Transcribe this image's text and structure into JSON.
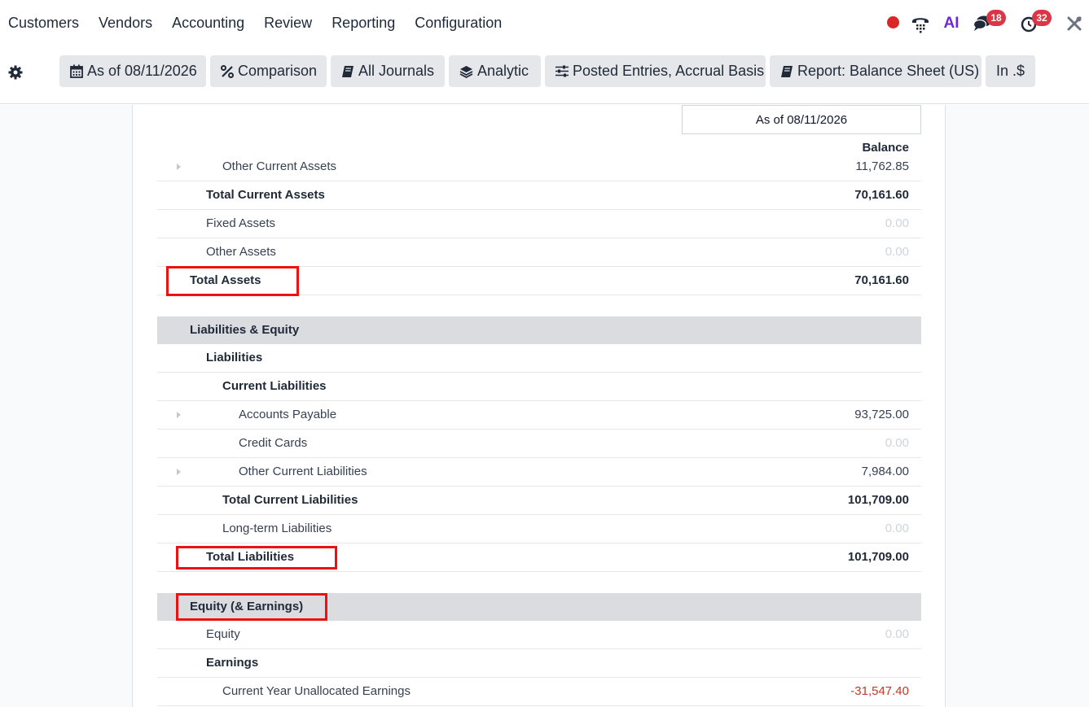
{
  "nav": {
    "menu": [
      "Customers",
      "Vendors",
      "Accounting",
      "Review",
      "Reporting",
      "Configuration"
    ],
    "ai_label": "AI",
    "messages_badge": "18",
    "activities_badge": "32"
  },
  "controls": {
    "date": "As of 08/11/2026",
    "comparison": "Comparison",
    "journals": "All Journals",
    "analytic": "Analytic",
    "entries": "Posted Entries, Accrual Basis",
    "report": "Report: Balance Sheet (US)",
    "currency": "In .$"
  },
  "report": {
    "column_header": "As of 08/11/2026",
    "balance_label": "Balance",
    "rows": [
      {
        "label": "Other Current Assets",
        "amount": "11,762.85"
      },
      {
        "label": "Total Current Assets",
        "amount": "70,161.60"
      },
      {
        "label": "Fixed Assets",
        "amount": "0.00"
      },
      {
        "label": "Other Assets",
        "amount": "0.00"
      },
      {
        "label": "Total Assets",
        "amount": "70,161.60"
      },
      {
        "label": "Liabilities & Equity",
        "amount": ""
      },
      {
        "label": "Liabilities",
        "amount": ""
      },
      {
        "label": "Current Liabilities",
        "amount": ""
      },
      {
        "label": "Accounts Payable",
        "amount": "93,725.00"
      },
      {
        "label": "Credit Cards",
        "amount": "0.00"
      },
      {
        "label": "Other Current Liabilities",
        "amount": "7,984.00"
      },
      {
        "label": "Total Current Liabilities",
        "amount": "101,709.00"
      },
      {
        "label": "Long-term Liabilities",
        "amount": "0.00"
      },
      {
        "label": "Total Liabilities",
        "amount": "101,709.00"
      },
      {
        "label": "Equity (& Earnings)",
        "amount": ""
      },
      {
        "label": "Equity",
        "amount": "0.00"
      },
      {
        "label": "Earnings",
        "amount": ""
      },
      {
        "label": "Current Year Unallocated Earnings",
        "amount": "-31,547.40"
      }
    ]
  },
  "colors": {
    "highlight": "#ee1111",
    "section_bg": "#dadce0",
    "negative": "#c0392b",
    "badge": "#dc3545"
  }
}
